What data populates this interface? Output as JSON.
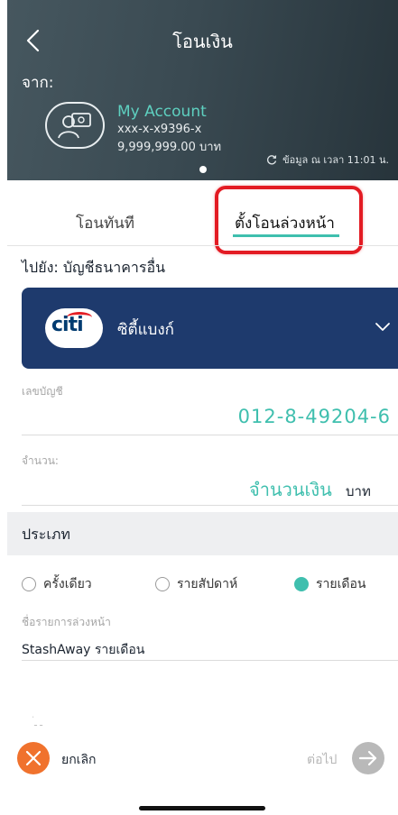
{
  "header": {
    "title": "โอนเงิน",
    "from_label": "จาก:",
    "account": {
      "name": "My Account",
      "number": "xxx-x-x9396-x",
      "balance": "9,999,999.00 บาท"
    },
    "refresh_text": "ข้อมูล ณ เวลา 11:01 น."
  },
  "tabs": {
    "now": "โอนทันที",
    "scheduled": "ตั้งโอนล่วงหน้า"
  },
  "to_label": "ไปยัง: บัญชีธนาคารอื่น",
  "bank": {
    "logo_text": "citi",
    "name": "ซิตี้แบงก์"
  },
  "account_field": {
    "label": "เลขบัญชี",
    "value": "012-8-49204-6"
  },
  "amount_field": {
    "label": "จำนวน:",
    "placeholder": "จำนวนเงิน",
    "unit": "บาท"
  },
  "type_section": {
    "title": "ประเภท",
    "options": [
      "ครั้งเดียว",
      "รายสัปดาห์",
      "รายเดือน"
    ],
    "selected": "รายเดือน"
  },
  "schedule_name": {
    "label": "ชื่อรายการล่วงหน้า",
    "value": "StashAway รายเดือน"
  },
  "footer": {
    "cancel": "ยกเลิก",
    "next": "ต่อไป"
  },
  "colors": {
    "accent": "#3fbfae",
    "bank_blue": "#1e3a6d",
    "cancel_orange": "#f0722d",
    "highlight_red": "#e31b23"
  }
}
